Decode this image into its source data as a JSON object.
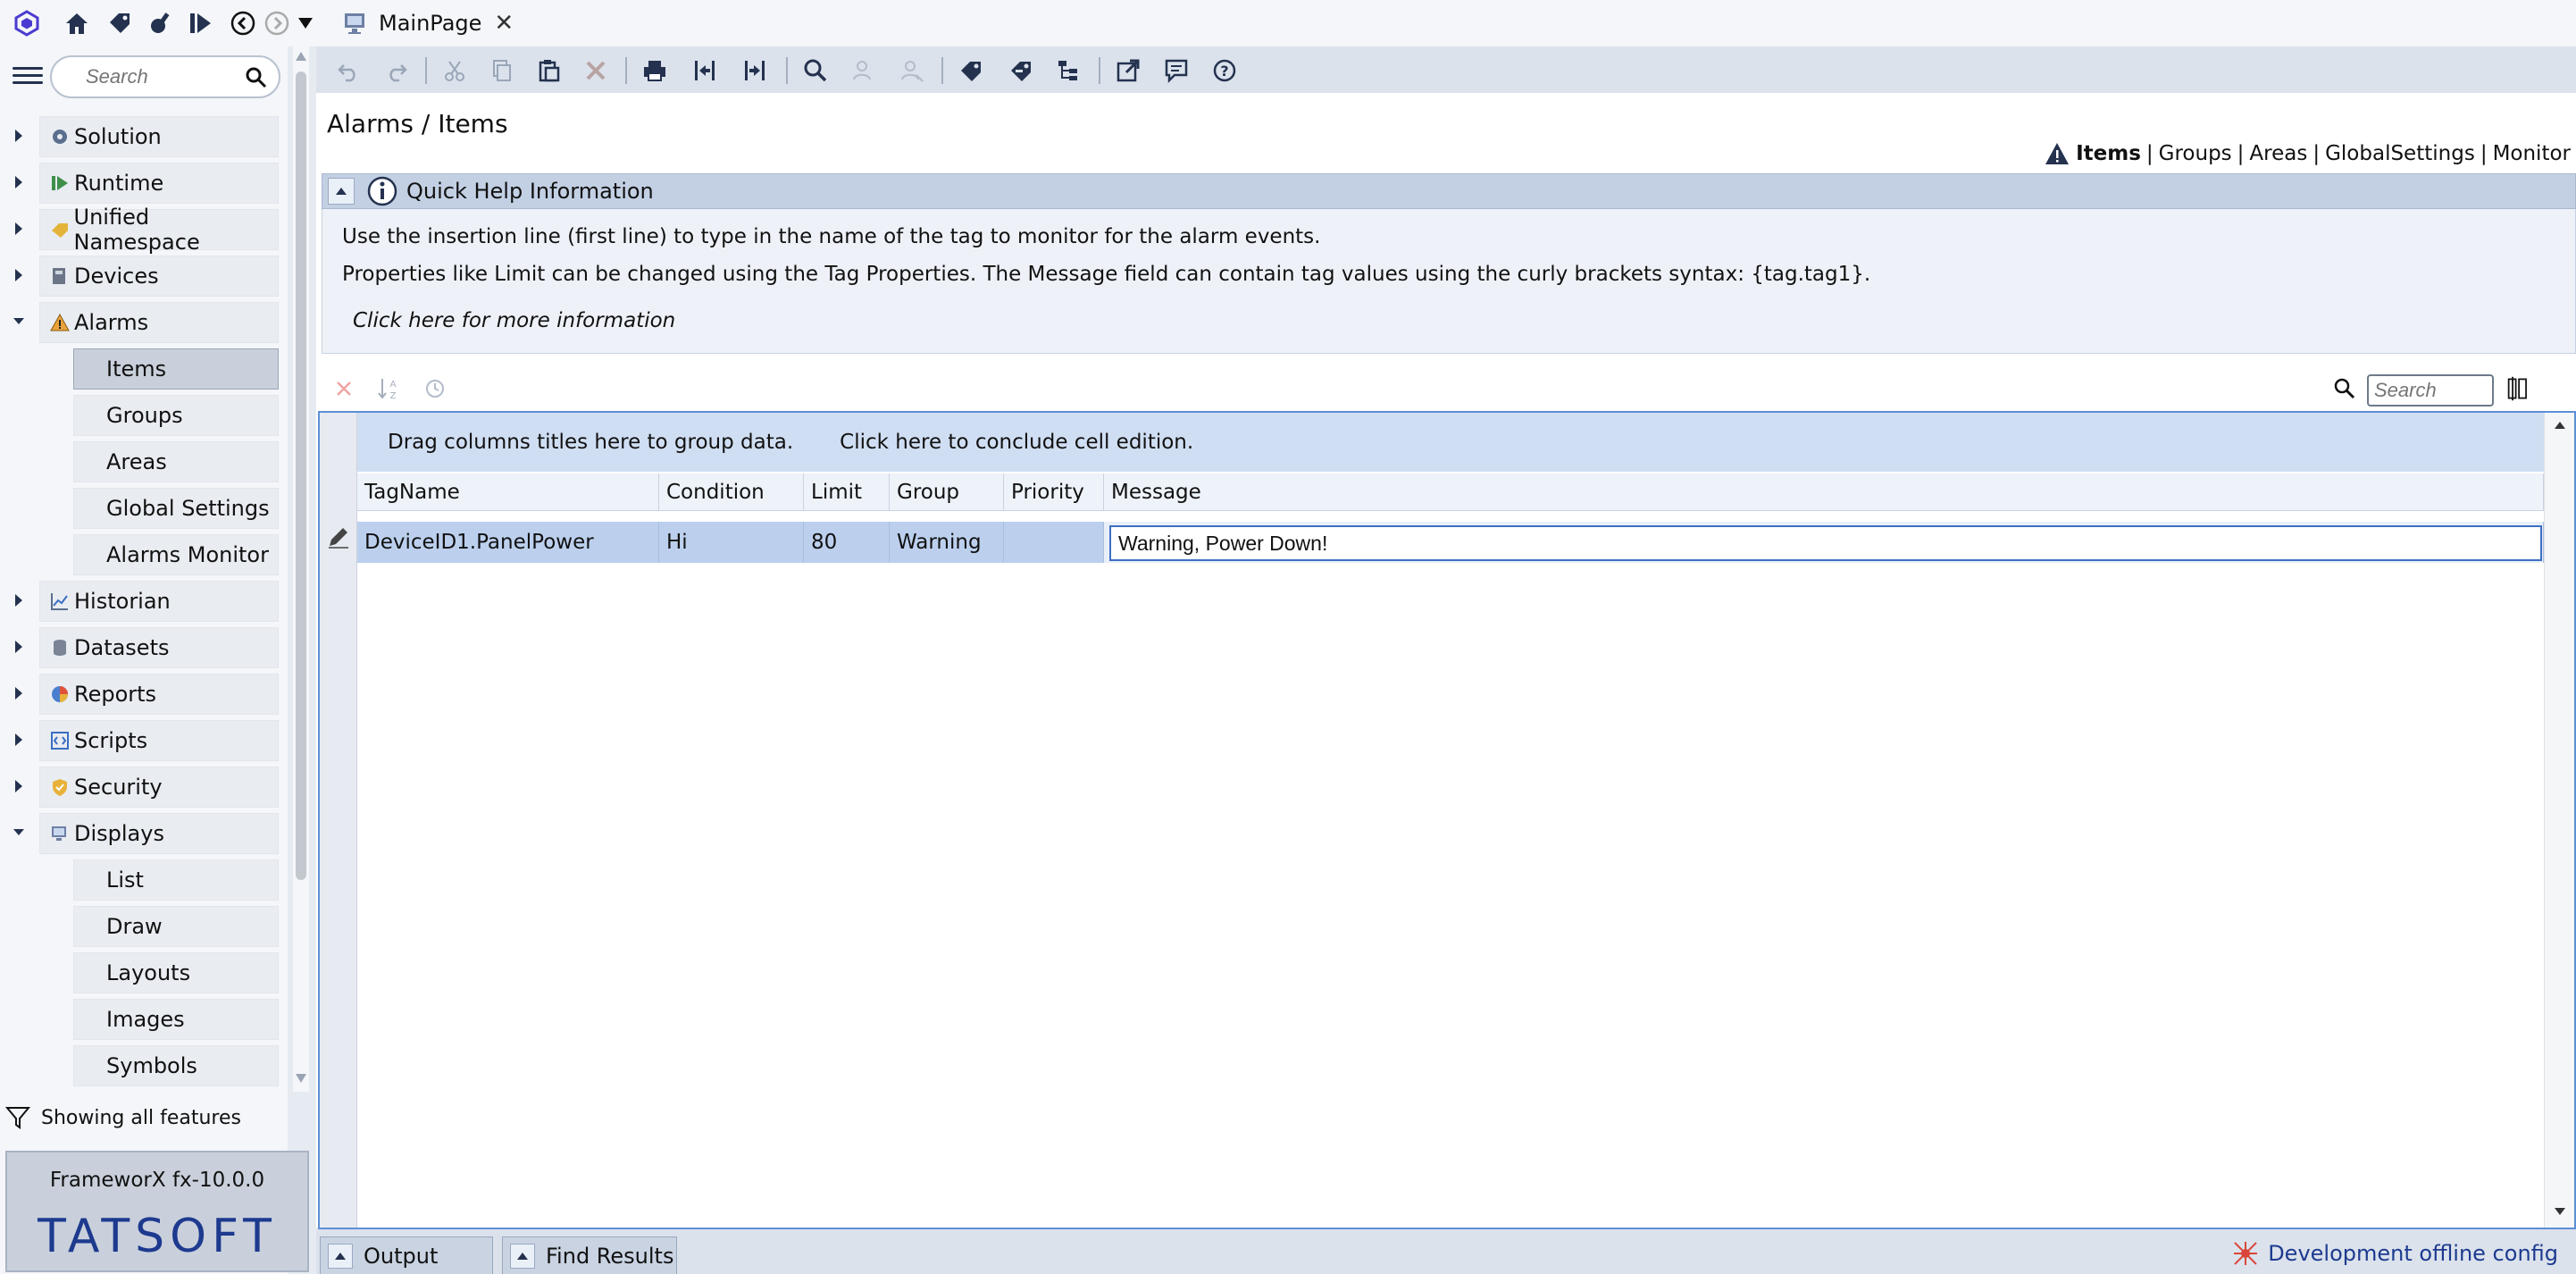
{
  "top": {
    "page_tab": "MainPage"
  },
  "sidebar": {
    "search_placeholder": "Search",
    "items": [
      {
        "label": "Solution",
        "icon": "gear-icon",
        "expanded": false
      },
      {
        "label": "Runtime",
        "icon": "runtime-icon",
        "expanded": false
      },
      {
        "label": "Unified Namespace",
        "icon": "tag-icon",
        "expanded": false
      },
      {
        "label": "Devices",
        "icon": "device-icon",
        "expanded": false
      },
      {
        "label": "Alarms",
        "icon": "warning-icon",
        "expanded": true
      },
      {
        "label": "Historian",
        "icon": "chart-icon",
        "expanded": false
      },
      {
        "label": "Datasets",
        "icon": "database-icon",
        "expanded": false
      },
      {
        "label": "Reports",
        "icon": "pie-icon",
        "expanded": false
      },
      {
        "label": "Scripts",
        "icon": "script-icon",
        "expanded": false
      },
      {
        "label": "Security",
        "icon": "shield-icon",
        "expanded": false
      },
      {
        "label": "Displays",
        "icon": "display-icon",
        "expanded": true
      }
    ],
    "alarms_children": [
      "Items",
      "Groups",
      "Areas",
      "Global Settings",
      "Alarms Monitor"
    ],
    "displays_children": [
      "List",
      "Draw",
      "Layouts",
      "Images",
      "Symbols"
    ],
    "filter_text": "Showing all features",
    "version": "FrameworX fx-10.0.0",
    "brand": "TATSOFT"
  },
  "main": {
    "breadcrumb": "Alarms / Items",
    "rightnav": {
      "active": "Items",
      "links": [
        "Groups",
        "Areas",
        "GlobalSettings",
        "Monitor"
      ]
    },
    "quick_help": {
      "title": "Quick Help Information",
      "line1": "Use the insertion line (first line) to type in the name of the tag to monitor for the alarm events.",
      "line2": "Properties like Limit can be changed using the Tag Properties. The Message field can contain tag values using the curly brackets syntax: {tag.tag1}.",
      "link": "Click here for more information"
    },
    "grid_search_placeholder": "Search",
    "group_hint": "Drag columns titles here to group data.",
    "conclude_hint": "Click here to conclude cell edition.",
    "columns": [
      "TagName",
      "Condition",
      "Limit",
      "Group",
      "Priority",
      "Message"
    ],
    "row": {
      "tagname": "DeviceID1.PanelPower",
      "condition": "Hi",
      "limit": "80",
      "group": "Warning",
      "priority": "",
      "message": "Warning, Power Down!"
    }
  },
  "bottom": {
    "tabs": [
      "Output",
      "Find Results"
    ],
    "status": "Development offline config"
  },
  "colors": {
    "accent": "#1d3a8f",
    "selection": "#bcd0ee",
    "sidebar_selected": "#c9d0db"
  }
}
